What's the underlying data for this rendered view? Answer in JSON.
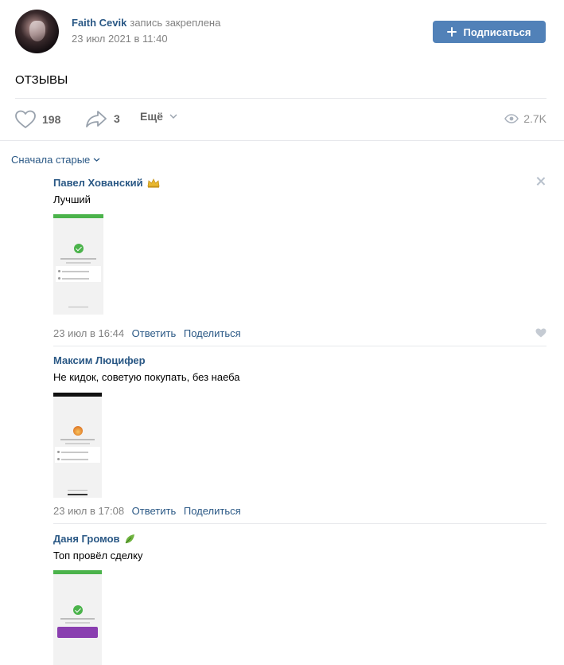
{
  "post": {
    "author_name": "Faith Cevik",
    "pinned_note": "запись закреплена",
    "date": "23 июл 2021 в 11:40",
    "subscribe_label": "Подписаться",
    "text": "ОТЗЫВЫ"
  },
  "actions": {
    "likes_count": "198",
    "shares_count": "3",
    "more_label": "Ещё",
    "views_count": "2.7K"
  },
  "comments_sort": "Сначала старые",
  "comments": [
    {
      "author": "Павел Хованский",
      "badge_icon": "crown-icon",
      "text": "Лучший",
      "date": "23 июл в 16:44",
      "reply_label": "Ответить",
      "share_label": "Поделиться"
    },
    {
      "author": "Максим Люцифер",
      "text": "Не кидок, советую покупать, без наеба",
      "date": "23 июл в 17:08",
      "reply_label": "Ответить",
      "share_label": "Поделиться"
    },
    {
      "author": "Даня Громов",
      "badge_icon": "leaf-icon",
      "text": "Топ провёл сделку"
    }
  ],
  "colors": {
    "link": "#2a5885",
    "button": "#5181b8",
    "muted": "#828282",
    "divider": "#e7e8ec"
  }
}
